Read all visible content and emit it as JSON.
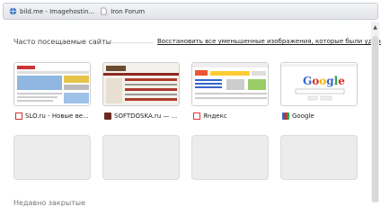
{
  "bookmarks": [
    {
      "label": "bild.me - Imagehostin...",
      "icon": "globe-icon"
    },
    {
      "label": "Iron Forum",
      "icon": "page-icon"
    }
  ],
  "section": {
    "title": "Часто посещаемые сайты",
    "restore_link": "Восстановить все уменьшенные изображения, которые были удалены"
  },
  "tiles": [
    {
      "title": "SLO.ru - Новые ве...",
      "icon": "slo-favicon"
    },
    {
      "title": "SOFTDOSKA.ru — ...",
      "icon": "softdoska-favicon"
    },
    {
      "title": "Яндекс",
      "icon": "yandex-favicon"
    },
    {
      "title": "Google",
      "icon": "google-favicon"
    }
  ],
  "bottom_title": "Недавно закрытые"
}
